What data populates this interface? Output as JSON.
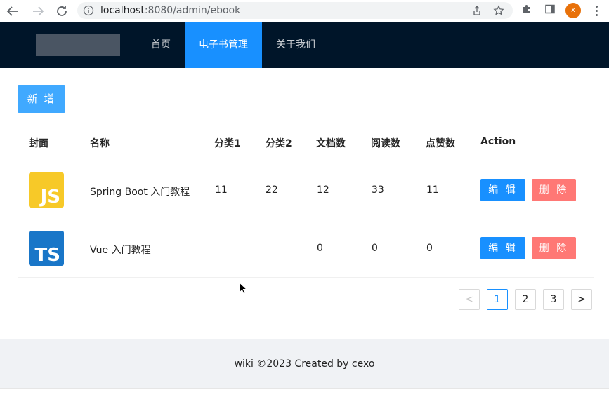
{
  "browser": {
    "url_host": "localhost",
    "url_path": ":8080/admin/ebook",
    "profile_initial": "x"
  },
  "header": {
    "menu": [
      {
        "label": "首页"
      },
      {
        "label": "电子书管理",
        "active": true
      },
      {
        "label": "关于我们"
      }
    ]
  },
  "toolbar": {
    "add_label": "新 增"
  },
  "table": {
    "columns": [
      "封面",
      "名称",
      "分类1",
      "分类2",
      "文档数",
      "阅读数",
      "点赞数",
      "Action"
    ],
    "rows": [
      {
        "cover_text": "JS",
        "cover_bg": "#f7c928",
        "cover_fg": "#ffffff",
        "name": "Spring Boot 入门教程",
        "category1": "11",
        "category2": "22",
        "doc_count": "12",
        "view_count": "33",
        "vote_count": "11",
        "edit_label": "编 辑",
        "delete_label": "删 除"
      },
      {
        "cover_text": "TS",
        "cover_bg": "#1976c8",
        "cover_fg": "#ffffff",
        "name": "Vue 入门教程",
        "category1": "",
        "category2": "",
        "doc_count": "0",
        "view_count": "0",
        "vote_count": "0",
        "edit_label": "编 辑",
        "delete_label": "删 除"
      }
    ]
  },
  "pagination": {
    "prev": "<",
    "pages": [
      "1",
      "2",
      "3"
    ],
    "current": "1",
    "next": ">"
  },
  "footer": {
    "text": "wiki ©2023 Created by cexo"
  },
  "colors": {
    "header_bg": "#001529",
    "primary": "#1890ff",
    "danger": "#ff7875"
  }
}
